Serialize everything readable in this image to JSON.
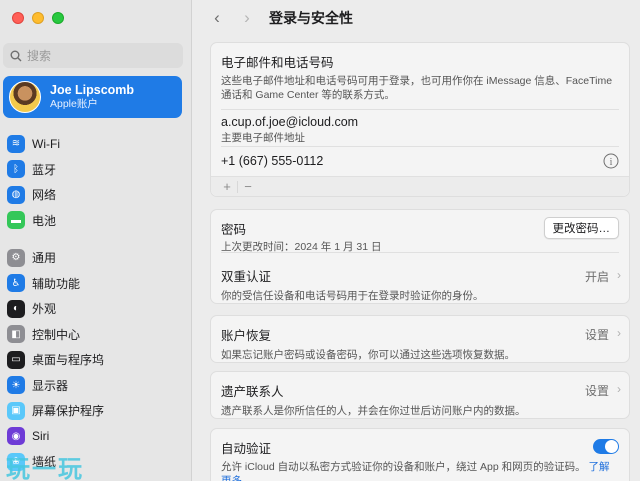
{
  "sidebar": {
    "search_placeholder": "搜索",
    "account": {
      "name": "Joe Lipscomb",
      "sub": "Apple账户"
    },
    "groups": [
      [
        {
          "label": "Wi-Fi",
          "icon": "wifi-icon",
          "color": "#1f7be6",
          "glyph": "≋"
        },
        {
          "label": "蓝牙",
          "icon": "bluetooth-icon",
          "color": "#1f7be6",
          "glyph": "ᛒ"
        },
        {
          "label": "网络",
          "icon": "network-icon",
          "color": "#1f7be6",
          "glyph": "◍"
        },
        {
          "label": "电池",
          "icon": "battery-icon",
          "color": "#34c759",
          "glyph": "▬"
        }
      ],
      [
        {
          "label": "通用",
          "icon": "gear-icon",
          "color": "#8e8e93",
          "glyph": "⚙"
        },
        {
          "label": "辅助功能",
          "icon": "accessibility-icon",
          "color": "#1f7be6",
          "glyph": "♿"
        },
        {
          "label": "外观",
          "icon": "appearance-icon",
          "color": "#1d1d1f",
          "glyph": "◐"
        },
        {
          "label": "控制中心",
          "icon": "control-center-icon",
          "color": "#8e8e93",
          "glyph": "◧"
        },
        {
          "label": "桌面与程序坞",
          "icon": "dock-icon",
          "color": "#1d1d1f",
          "glyph": "▭"
        },
        {
          "label": "显示器",
          "icon": "display-icon",
          "color": "#1f7be6",
          "glyph": "☀"
        },
        {
          "label": "屏幕保护程序",
          "icon": "screensaver-icon",
          "color": "#5ac8fa",
          "glyph": "▣"
        },
        {
          "label": "Siri",
          "icon": "siri-icon",
          "color": "#6e3bd6",
          "glyph": "◉"
        },
        {
          "label": "墙纸",
          "icon": "wallpaper-icon",
          "color": "#5ac8fa",
          "glyph": "❀"
        }
      ]
    ],
    "watermark": "玩一玩"
  },
  "header": {
    "title": "登录与安全性"
  },
  "email_card": {
    "title": "电子邮件和电话号码",
    "desc": "这些电子邮件地址和电话号码可用于登录，也可用作你在 iMessage 信息、FaceTime 通话和 Game Center 等的联系方式。",
    "email": "a.cup.of.joe@icloud.com",
    "email_sub": "主要电子邮件地址",
    "phone": "+1 (667) 555-0112",
    "add": "+",
    "remove": "−"
  },
  "security_card": {
    "password_label": "密码",
    "password_sub": "上次更改时间：2024 年 1 月 31 日",
    "change_password": "更改密码…",
    "twofa_label": "双重认证",
    "twofa_desc": "你的受信任设备和电话号码用于在登录时验证你的身份。",
    "twofa_value": "开启"
  },
  "recovery_card": {
    "label": "账户恢复",
    "desc": "如果忘记账户密码或设备密码，你可以通过这些选项恢复数据。",
    "value": "设置"
  },
  "legacy_card": {
    "label": "遗产联系人",
    "desc": "遗产联系人是你所信任的人，并会在你过世后访问账户内的数据。",
    "value": "设置"
  },
  "autoverify_card": {
    "label": "自动验证",
    "desc": "允许 iCloud 自动以私密方式验证你的设备和账户，绕过 App 和网页的验证码。",
    "link": "了解更多…"
  }
}
